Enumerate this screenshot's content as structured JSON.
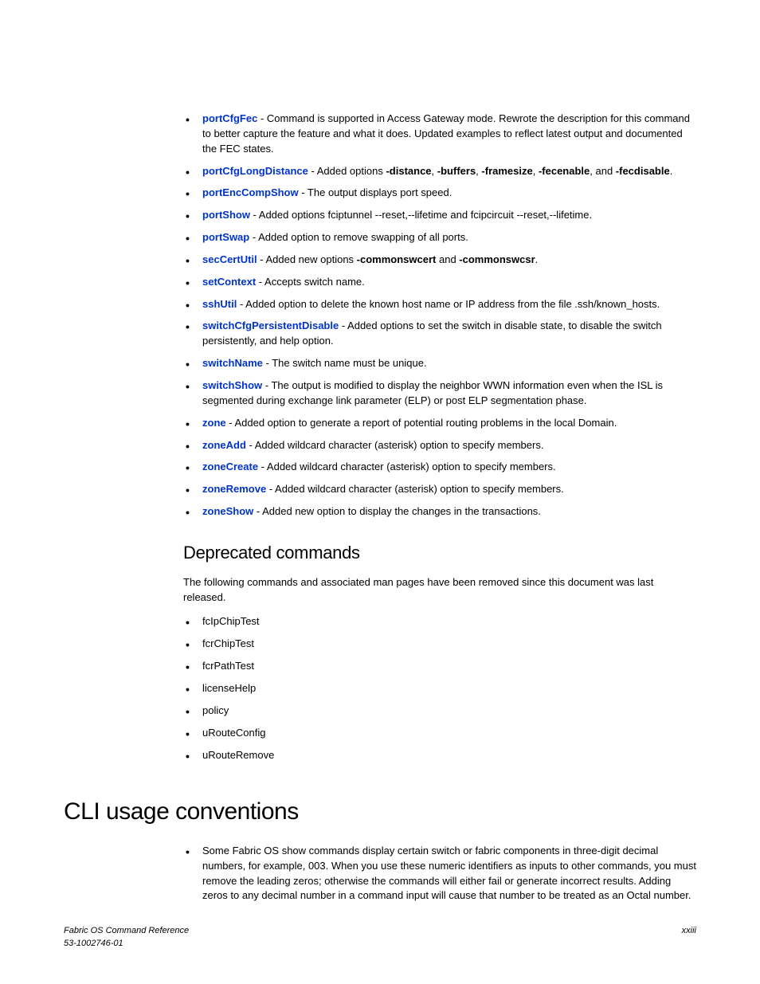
{
  "modifiedCommands": [
    {
      "cmd": "portCfgFec",
      "desc": " - Command is supported in Access Gateway mode. Rewrote the description for this command to better capture the feature and what it does. Updated examples to reflect latest output and documented the FEC states."
    },
    {
      "cmd": "portCfgLongDistance",
      "desc": " - Added options ",
      "boldParts": [
        "-distance",
        "-buffers",
        "-framesize",
        "-fecenable",
        "-fecdisable"
      ],
      "separators": [
        ", ",
        ", ",
        ", ",
        ", and "
      ],
      "tail": "."
    },
    {
      "cmd": "portEncCompShow",
      "desc": " - The output displays port speed."
    },
    {
      "cmd": "portShow",
      "desc": " - Added options fciptunnel --reset,--lifetime and fcipcircuit --reset,--lifetime."
    },
    {
      "cmd": "portSwap",
      "desc": " - Added option to remove swapping of all ports."
    },
    {
      "cmd": "secCertUtil",
      "desc": " - Added new options ",
      "boldParts": [
        "-commonswcert",
        "-commonswcsr"
      ],
      "separators": [
        " and "
      ],
      "tail": "."
    },
    {
      "cmd": "setContext",
      "desc": " - Accepts switch name."
    },
    {
      "cmd": "sshUtil",
      "desc": " - Added option to delete the known host name or IP address from the file .ssh/known_hosts."
    },
    {
      "cmd": "switchCfgPersistentDisable",
      "desc": " - Added options to set the switch in disable state, to disable the switch persistently, and help option."
    },
    {
      "cmd": "switchName",
      "desc": " - The switch name must be unique."
    },
    {
      "cmd": "switchShow",
      "desc": " - The output is modified to display the neighbor WWN information even when the ISL is segmented during exchange link parameter (ELP) or post ELP segmentation phase."
    },
    {
      "cmd": "zone",
      "desc": " - Added option to generate a report of potential routing problems in the local Domain."
    },
    {
      "cmd": "zoneAdd",
      "desc": " - Added wildcard character (asterisk) option to specify members."
    },
    {
      "cmd": "zoneCreate",
      "desc": " - Added wildcard character (asterisk) option to specify members."
    },
    {
      "cmd": "zoneRemove",
      "desc": " - Added wildcard character (asterisk) option to specify members."
    },
    {
      "cmd": "zoneShow",
      "desc": " - Added new option to display the changes in the transactions."
    }
  ],
  "deprecated": {
    "heading": "Deprecated commands",
    "intro": "The following commands and associated man pages have been removed since this document was last released.",
    "items": [
      "fcIpChipTest",
      "fcrChipTest",
      "fcrPathTest",
      "licenseHelp",
      "policy",
      "uRouteConfig",
      "uRouteRemove"
    ]
  },
  "cliUsage": {
    "heading": "CLI usage conventions",
    "items": [
      "Some Fabric OS show commands display certain switch or fabric components in three-digit decimal numbers, for example, 003. When you use these numeric identifiers as inputs to other commands, you must remove the leading zeros; otherwise the commands will either fail or generate incorrect results. Adding zeros to any decimal number in a command input will cause that number to be treated as an Octal number."
    ]
  },
  "footer": {
    "leftLine1": "Fabric OS Command Reference",
    "leftLine2": "53-1002746-01",
    "right": "xxiii"
  }
}
